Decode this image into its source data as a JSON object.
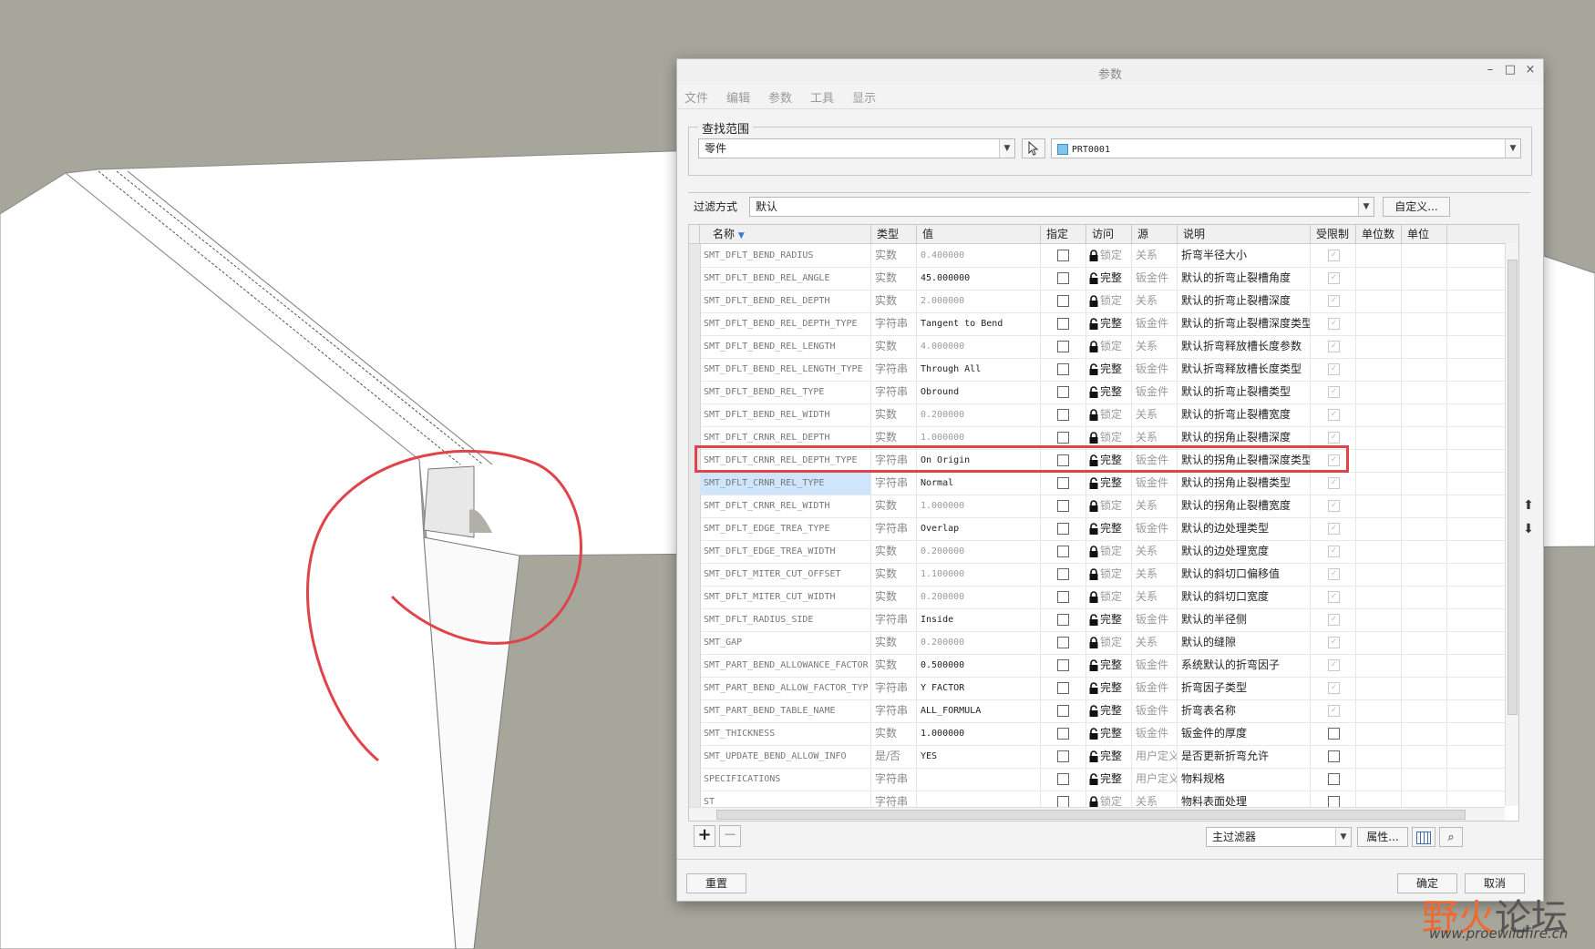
{
  "dialog": {
    "title": "参数",
    "minimize": "–",
    "maximize": "□",
    "close": "×",
    "menu": [
      "文件",
      "编辑",
      "参数",
      "工具",
      "显示"
    ]
  },
  "scope": {
    "label": "查找范围",
    "type_value": "零件",
    "model_value": "PRT0001"
  },
  "filter": {
    "label": "过滤方式",
    "value": "默认",
    "customize_label": "自定义..."
  },
  "table": {
    "columns": [
      "名称",
      "类型",
      "值",
      "指定",
      "访问",
      "源",
      "说明",
      "受限制",
      "单位数",
      "单位"
    ],
    "rows": [
      {
        "name": "SMT_DFLT_BEND_RADIUS",
        "type": "实数",
        "value": "0.400000",
        "locked": true,
        "access": "锁定",
        "source": "关系",
        "desc": "折弯半径大小",
        "restricted": true
      },
      {
        "name": "SMT_DFLT_BEND_REL_ANGLE",
        "type": "实数",
        "value": "45.000000",
        "locked": false,
        "access": "完整",
        "source": "钣金件",
        "desc": "默认的折弯止裂槽角度",
        "restricted": true
      },
      {
        "name": "SMT_DFLT_BEND_REL_DEPTH",
        "type": "实数",
        "value": "2.000000",
        "locked": true,
        "access": "锁定",
        "source": "关系",
        "desc": "默认的折弯止裂槽深度",
        "restricted": true
      },
      {
        "name": "SMT_DFLT_BEND_REL_DEPTH_TYPE",
        "type": "字符串",
        "value": "Tangent to Bend",
        "locked": false,
        "access": "完整",
        "source": "钣金件",
        "desc": "默认的折弯止裂槽深度类型",
        "restricted": true
      },
      {
        "name": "SMT_DFLT_BEND_REL_LENGTH",
        "type": "实数",
        "value": "4.000000",
        "locked": true,
        "access": "锁定",
        "source": "关系",
        "desc": "默认折弯释放槽长度参数",
        "restricted": true
      },
      {
        "name": "SMT_DFLT_BEND_REL_LENGTH_TYPE",
        "type": "字符串",
        "value": "Through All",
        "locked": false,
        "access": "完整",
        "source": "钣金件",
        "desc": "默认折弯释放槽长度类型",
        "restricted": true
      },
      {
        "name": "SMT_DFLT_BEND_REL_TYPE",
        "type": "字符串",
        "value": "Obround",
        "locked": false,
        "access": "完整",
        "source": "钣金件",
        "desc": "默认的折弯止裂槽类型",
        "restricted": true
      },
      {
        "name": "SMT_DFLT_BEND_REL_WIDTH",
        "type": "实数",
        "value": "0.200000",
        "locked": true,
        "access": "锁定",
        "source": "关系",
        "desc": "默认的折弯止裂槽宽度",
        "restricted": true
      },
      {
        "name": "SMT_DFLT_CRNR_REL_DEPTH",
        "type": "实数",
        "value": "1.000000",
        "locked": true,
        "access": "锁定",
        "source": "关系",
        "desc": "默认的拐角止裂槽深度",
        "restricted": true
      },
      {
        "name": "SMT_DFLT_CRNR_REL_DEPTH_TYPE",
        "type": "字符串",
        "value": "On Origin",
        "locked": false,
        "access": "完整",
        "source": "钣金件",
        "desc": "默认的拐角止裂槽深度类型",
        "restricted": true
      },
      {
        "name": "SMT_DFLT_CRNR_REL_TYPE",
        "type": "字符串",
        "value": "Normal",
        "locked": false,
        "access": "完整",
        "source": "钣金件",
        "desc": "默认的拐角止裂槽类型",
        "restricted": true,
        "selected": true
      },
      {
        "name": "SMT_DFLT_CRNR_REL_WIDTH",
        "type": "实数",
        "value": "1.000000",
        "locked": true,
        "access": "锁定",
        "source": "关系",
        "desc": "默认的拐角止裂槽宽度",
        "restricted": true
      },
      {
        "name": "SMT_DFLT_EDGE_TREA_TYPE",
        "type": "字符串",
        "value": "Overlap",
        "locked": false,
        "access": "完整",
        "source": "钣金件",
        "desc": "默认的边处理类型",
        "restricted": true
      },
      {
        "name": "SMT_DFLT_EDGE_TREA_WIDTH",
        "type": "实数",
        "value": "0.200000",
        "locked": true,
        "access": "锁定",
        "source": "关系",
        "desc": "默认的边处理宽度",
        "restricted": true
      },
      {
        "name": "SMT_DFLT_MITER_CUT_OFFSET",
        "type": "实数",
        "value": "1.100000",
        "locked": true,
        "access": "锁定",
        "source": "关系",
        "desc": "默认的斜切口偏移值",
        "restricted": true
      },
      {
        "name": "SMT_DFLT_MITER_CUT_WIDTH",
        "type": "实数",
        "value": "0.200000",
        "locked": true,
        "access": "锁定",
        "source": "关系",
        "desc": "默认的斜切口宽度",
        "restricted": true
      },
      {
        "name": "SMT_DFLT_RADIUS_SIDE",
        "type": "字符串",
        "value": "Inside",
        "locked": false,
        "access": "完整",
        "source": "钣金件",
        "desc": "默认的半径侧",
        "restricted": true
      },
      {
        "name": "SMT_GAP",
        "type": "实数",
        "value": "0.200000",
        "locked": true,
        "access": "锁定",
        "source": "关系",
        "desc": "默认的缝隙",
        "restricted": true
      },
      {
        "name": "SMT_PART_BEND_ALLOWANCE_FACTOR",
        "type": "实数",
        "value": "0.500000",
        "locked": false,
        "access": "完整",
        "source": "钣金件",
        "desc": "系统默认的折弯因子",
        "restricted": true
      },
      {
        "name": "SMT_PART_BEND_ALLOW_FACTOR_TYP",
        "type": "字符串",
        "value": "Y FACTOR",
        "locked": false,
        "access": "完整",
        "source": "钣金件",
        "desc": "折弯因子类型",
        "restricted": true
      },
      {
        "name": "SMT_PART_BEND_TABLE_NAME",
        "type": "字符串",
        "value": "ALL_FORMULA",
        "locked": false,
        "access": "完整",
        "source": "钣金件",
        "desc": "折弯表名称",
        "restricted": true
      },
      {
        "name": "SMT_THICKNESS",
        "type": "实数",
        "value": "1.000000",
        "locked": false,
        "access": "完整",
        "source": "钣金件",
        "desc": "钣金件的厚度",
        "restricted": false
      },
      {
        "name": "SMT_UPDATE_BEND_ALLOW_INFO",
        "type": "是/否",
        "value": "YES",
        "locked": false,
        "access": "完整",
        "source": "用户定义",
        "desc": "是否更新折弯允许",
        "restricted": false
      },
      {
        "name": "SPECIFICATIONS",
        "type": "字符串",
        "value": "",
        "locked": false,
        "access": "完整",
        "source": "用户定义",
        "desc": "物料规格",
        "restricted": false
      },
      {
        "name": "ST",
        "type": "字符串",
        "value": "",
        "locked": true,
        "access": "锁定",
        "source": "关系",
        "desc": "物料表面处理",
        "restricted": false
      }
    ]
  },
  "bottom": {
    "add": "+",
    "remove": "−",
    "main_filter": "主过滤器",
    "properties": "属性..."
  },
  "footer": {
    "reset": "重置",
    "ok": "确定",
    "cancel": "取消"
  },
  "watermark": {
    "brand_red": "野火",
    "brand_gray": "论坛",
    "url": "www.proewildfire.cn"
  },
  "colors": {
    "annotation_red": "#e0434a",
    "selection_blue": "#cfe5fb"
  }
}
